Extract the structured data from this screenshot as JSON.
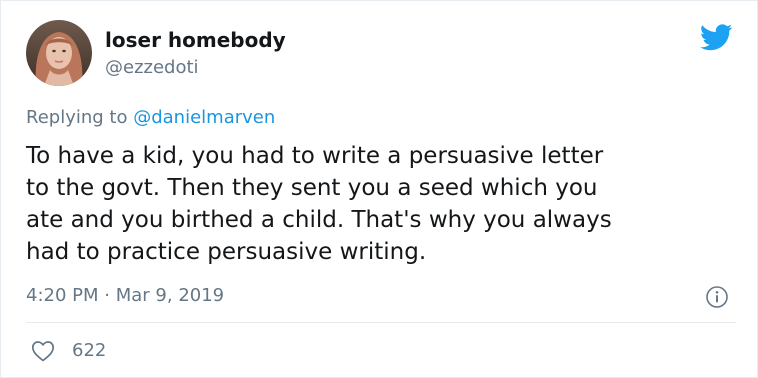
{
  "author": {
    "display_name": "loser homebody",
    "handle": "@ezzedoti"
  },
  "reply": {
    "prefix": "Replying to",
    "to_handle": "@danielmarven"
  },
  "tweet": {
    "lines": [
      "To have a kid, you had to write a persuasive letter",
      "to the govt. Then they sent you a seed which you",
      "ate and you birthed a child. That's why you always",
      "had to practice persuasive writing."
    ]
  },
  "meta": {
    "time": "4:20 PM",
    "separator": "·",
    "date": "Mar 9, 2019"
  },
  "engagement": {
    "likes": "622"
  },
  "icons": {
    "brand": "twitter-bird-icon",
    "info": "info-icon",
    "like": "heart-icon"
  },
  "colors": {
    "twitter_blue": "#1da1f2",
    "text_primary": "#14171a",
    "text_secondary": "#657786",
    "link": "#1b95e0",
    "divider": "#e6ecf0"
  }
}
